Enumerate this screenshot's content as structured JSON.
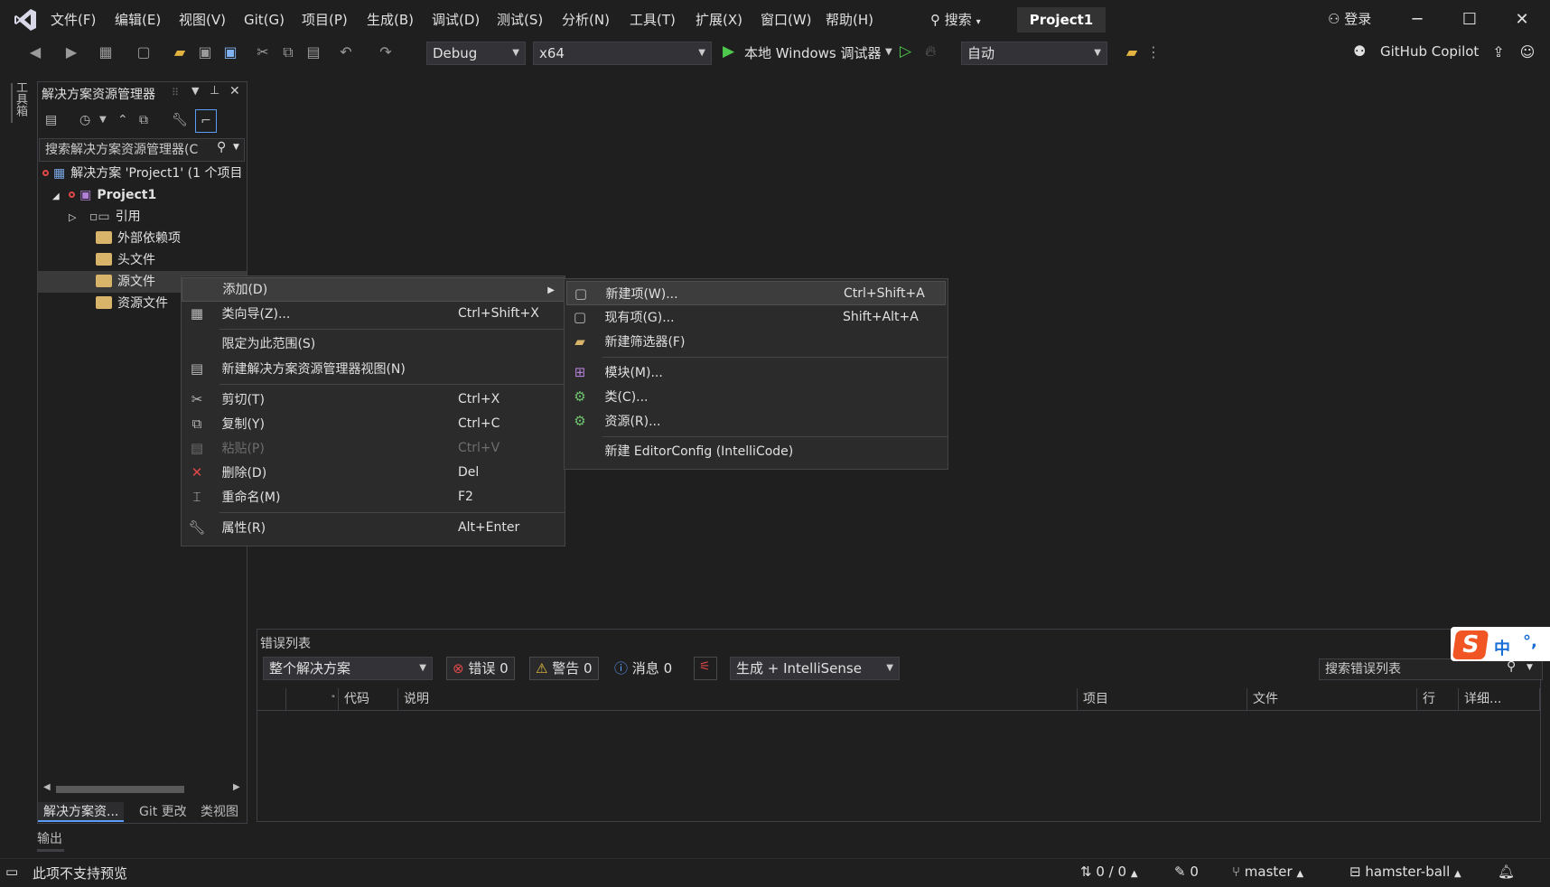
{
  "menu": [
    "文件(F)",
    "编辑(E)",
    "视图(V)",
    "Git(G)",
    "项目(P)",
    "生成(B)",
    "调试(D)",
    "测试(S)",
    "分析(N)",
    "工具(T)",
    "扩展(X)",
    "窗口(W)",
    "帮助(H)"
  ],
  "titlebar": {
    "search_label": "搜索",
    "project_name": "Project1",
    "login_label": "登录"
  },
  "toolbar": {
    "config": "Debug",
    "platform": "x64",
    "run_label": "本地 Windows 调试器",
    "auto": "自动",
    "copilot": "GitHub Copilot"
  },
  "toolbox_strip": "工具箱",
  "solution_explorer": {
    "title": "解决方案资源管理器",
    "search_placeholder": "搜索解决方案资源管理器(C",
    "tree": {
      "solution": "解决方案 'Project1' (1 个项目",
      "project": "Project1",
      "references": "引用",
      "external": "外部依赖项",
      "headers": "头文件",
      "sources": "源文件",
      "resources": "资源文件"
    },
    "tabs": [
      "解决方案资...",
      "Git 更改",
      "类视图"
    ]
  },
  "output_tab": "输出",
  "error_list": {
    "title": "错误列表",
    "scope": "整个解决方案",
    "errors": "错误 0",
    "warnings": "警告 0",
    "messages": "消息 0",
    "build_filter": "生成 + IntelliSense",
    "search_placeholder": "搜索错误列表",
    "columns": {
      "code": "代码",
      "desc": "说明",
      "project": "项目",
      "file": "文件",
      "line": "行",
      "detail": "详细..."
    }
  },
  "context_menu": {
    "add": "添加(D)",
    "class_wizard": "类向导(Z)...",
    "class_wizard_sc": "Ctrl+Shift+X",
    "scope": "限定为此范围(S)",
    "new_view": "新建解决方案资源管理器视图(N)",
    "cut": "剪切(T)",
    "cut_sc": "Ctrl+X",
    "copy": "复制(Y)",
    "copy_sc": "Ctrl+C",
    "paste": "粘贴(P)",
    "paste_sc": "Ctrl+V",
    "delete": "删除(D)",
    "delete_sc": "Del",
    "rename": "重命名(M)",
    "rename_sc": "F2",
    "properties": "属性(R)",
    "properties_sc": "Alt+Enter"
  },
  "submenu": {
    "new_item": "新建项(W)...",
    "new_item_sc": "Ctrl+Shift+A",
    "existing_item": "现有项(G)...",
    "existing_item_sc": "Shift+Alt+A",
    "new_filter": "新建筛选器(F)",
    "module": "模块(M)...",
    "class": "类(C)...",
    "resource": "资源(R)...",
    "editorconfig": "新建 EditorConfig (IntelliCode)"
  },
  "ime": {
    "mode": "中",
    "punct": "°,"
  },
  "statusbar": {
    "preview": "此项不支持预览",
    "sync": "0 / 0",
    "changes": "0",
    "branch": "master",
    "repo": "hamster-ball"
  },
  "colors": {
    "accent": "#5a9cf8",
    "run_green": "#4ec94e",
    "error_red": "#e04848",
    "warning_yellow": "#e8c13a"
  }
}
